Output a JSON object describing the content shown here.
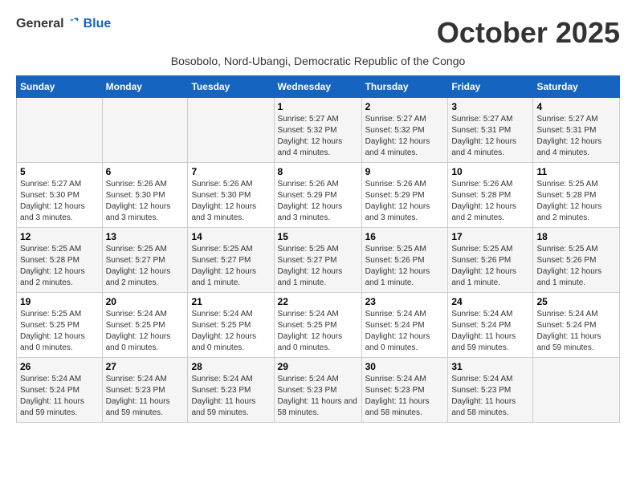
{
  "logo": {
    "general": "General",
    "blue": "Blue"
  },
  "title": "October 2025",
  "subtitle": "Bosobolo, Nord-Ubangi, Democratic Republic of the Congo",
  "headers": [
    "Sunday",
    "Monday",
    "Tuesday",
    "Wednesday",
    "Thursday",
    "Friday",
    "Saturday"
  ],
  "weeks": [
    [
      {
        "day": "",
        "info": ""
      },
      {
        "day": "",
        "info": ""
      },
      {
        "day": "",
        "info": ""
      },
      {
        "day": "1",
        "sunrise": "Sunrise: 5:27 AM",
        "sunset": "Sunset: 5:32 PM",
        "daylight": "Daylight: 12 hours and 4 minutes."
      },
      {
        "day": "2",
        "sunrise": "Sunrise: 5:27 AM",
        "sunset": "Sunset: 5:32 PM",
        "daylight": "Daylight: 12 hours and 4 minutes."
      },
      {
        "day": "3",
        "sunrise": "Sunrise: 5:27 AM",
        "sunset": "Sunset: 5:31 PM",
        "daylight": "Daylight: 12 hours and 4 minutes."
      },
      {
        "day": "4",
        "sunrise": "Sunrise: 5:27 AM",
        "sunset": "Sunset: 5:31 PM",
        "daylight": "Daylight: 12 hours and 4 minutes."
      }
    ],
    [
      {
        "day": "5",
        "sunrise": "Sunrise: 5:27 AM",
        "sunset": "Sunset: 5:30 PM",
        "daylight": "Daylight: 12 hours and 3 minutes."
      },
      {
        "day": "6",
        "sunrise": "Sunrise: 5:26 AM",
        "sunset": "Sunset: 5:30 PM",
        "daylight": "Daylight: 12 hours and 3 minutes."
      },
      {
        "day": "7",
        "sunrise": "Sunrise: 5:26 AM",
        "sunset": "Sunset: 5:30 PM",
        "daylight": "Daylight: 12 hours and 3 minutes."
      },
      {
        "day": "8",
        "sunrise": "Sunrise: 5:26 AM",
        "sunset": "Sunset: 5:29 PM",
        "daylight": "Daylight: 12 hours and 3 minutes."
      },
      {
        "day": "9",
        "sunrise": "Sunrise: 5:26 AM",
        "sunset": "Sunset: 5:29 PM",
        "daylight": "Daylight: 12 hours and 3 minutes."
      },
      {
        "day": "10",
        "sunrise": "Sunrise: 5:26 AM",
        "sunset": "Sunset: 5:28 PM",
        "daylight": "Daylight: 12 hours and 2 minutes."
      },
      {
        "day": "11",
        "sunrise": "Sunrise: 5:25 AM",
        "sunset": "Sunset: 5:28 PM",
        "daylight": "Daylight: 12 hours and 2 minutes."
      }
    ],
    [
      {
        "day": "12",
        "sunrise": "Sunrise: 5:25 AM",
        "sunset": "Sunset: 5:28 PM",
        "daylight": "Daylight: 12 hours and 2 minutes."
      },
      {
        "day": "13",
        "sunrise": "Sunrise: 5:25 AM",
        "sunset": "Sunset: 5:27 PM",
        "daylight": "Daylight: 12 hours and 2 minutes."
      },
      {
        "day": "14",
        "sunrise": "Sunrise: 5:25 AM",
        "sunset": "Sunset: 5:27 PM",
        "daylight": "Daylight: 12 hours and 1 minute."
      },
      {
        "day": "15",
        "sunrise": "Sunrise: 5:25 AM",
        "sunset": "Sunset: 5:27 PM",
        "daylight": "Daylight: 12 hours and 1 minute."
      },
      {
        "day": "16",
        "sunrise": "Sunrise: 5:25 AM",
        "sunset": "Sunset: 5:26 PM",
        "daylight": "Daylight: 12 hours and 1 minute."
      },
      {
        "day": "17",
        "sunrise": "Sunrise: 5:25 AM",
        "sunset": "Sunset: 5:26 PM",
        "daylight": "Daylight: 12 hours and 1 minute."
      },
      {
        "day": "18",
        "sunrise": "Sunrise: 5:25 AM",
        "sunset": "Sunset: 5:26 PM",
        "daylight": "Daylight: 12 hours and 1 minute."
      }
    ],
    [
      {
        "day": "19",
        "sunrise": "Sunrise: 5:25 AM",
        "sunset": "Sunset: 5:25 PM",
        "daylight": "Daylight: 12 hours and 0 minutes."
      },
      {
        "day": "20",
        "sunrise": "Sunrise: 5:24 AM",
        "sunset": "Sunset: 5:25 PM",
        "daylight": "Daylight: 12 hours and 0 minutes."
      },
      {
        "day": "21",
        "sunrise": "Sunrise: 5:24 AM",
        "sunset": "Sunset: 5:25 PM",
        "daylight": "Daylight: 12 hours and 0 minutes."
      },
      {
        "day": "22",
        "sunrise": "Sunrise: 5:24 AM",
        "sunset": "Sunset: 5:25 PM",
        "daylight": "Daylight: 12 hours and 0 minutes."
      },
      {
        "day": "23",
        "sunrise": "Sunrise: 5:24 AM",
        "sunset": "Sunset: 5:24 PM",
        "daylight": "Daylight: 12 hours and 0 minutes."
      },
      {
        "day": "24",
        "sunrise": "Sunrise: 5:24 AM",
        "sunset": "Sunset: 5:24 PM",
        "daylight": "Daylight: 11 hours and 59 minutes."
      },
      {
        "day": "25",
        "sunrise": "Sunrise: 5:24 AM",
        "sunset": "Sunset: 5:24 PM",
        "daylight": "Daylight: 11 hours and 59 minutes."
      }
    ],
    [
      {
        "day": "26",
        "sunrise": "Sunrise: 5:24 AM",
        "sunset": "Sunset: 5:24 PM",
        "daylight": "Daylight: 11 hours and 59 minutes."
      },
      {
        "day": "27",
        "sunrise": "Sunrise: 5:24 AM",
        "sunset": "Sunset: 5:23 PM",
        "daylight": "Daylight: 11 hours and 59 minutes."
      },
      {
        "day": "28",
        "sunrise": "Sunrise: 5:24 AM",
        "sunset": "Sunset: 5:23 PM",
        "daylight": "Daylight: 11 hours and 59 minutes."
      },
      {
        "day": "29",
        "sunrise": "Sunrise: 5:24 AM",
        "sunset": "Sunset: 5:23 PM",
        "daylight": "Daylight: 11 hours and 58 minutes."
      },
      {
        "day": "30",
        "sunrise": "Sunrise: 5:24 AM",
        "sunset": "Sunset: 5:23 PM",
        "daylight": "Daylight: 11 hours and 58 minutes."
      },
      {
        "day": "31",
        "sunrise": "Sunrise: 5:24 AM",
        "sunset": "Sunset: 5:23 PM",
        "daylight": "Daylight: 11 hours and 58 minutes."
      },
      {
        "day": "",
        "info": ""
      }
    ]
  ]
}
